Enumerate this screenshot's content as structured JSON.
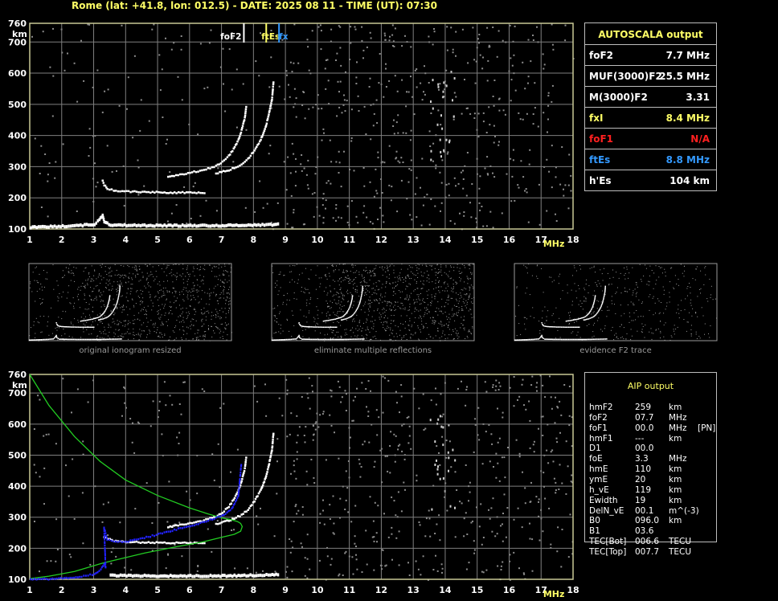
{
  "header": "Rome (lat: +41.8, lon: 012.5) - DATE: 2025 08 11 - TIME (UT): 07:30",
  "colors": {
    "background": "#000000",
    "grid": "#7f7f7f",
    "frame": "#c8c896",
    "trace": "#ffffff",
    "noise": "#8c8c8c",
    "label_yellow": "#ffff66",
    "label_red": "#ff2020",
    "label_blue": "#3399ff",
    "profile_green": "#22cc22",
    "fit_blue": "#2222ff"
  },
  "autoscala": {
    "title": "AUTOSCALA output",
    "rows": [
      {
        "name": "foF2",
        "value": "7.7 MHz",
        "color": "#ffffff"
      },
      {
        "name": "MUF(3000)F2",
        "value": "25.5 MHz",
        "color": "#ffffff"
      },
      {
        "name": "M(3000)F2",
        "value": "3.31",
        "color": "#ffffff"
      },
      {
        "name": "fxI",
        "value": "8.4 MHz",
        "color": "#ffff66"
      },
      {
        "name": "foF1",
        "value": "N/A",
        "color": "#ff2020"
      },
      {
        "name": "ftEs",
        "value": "8.8 MHz",
        "color": "#3399ff"
      },
      {
        "name": "h'Es",
        "value": "104    km",
        "color": "#ffffff"
      }
    ]
  },
  "aip": {
    "title": "AIP output",
    "rows": [
      {
        "name": "hmF2",
        "value": "259",
        "unit": "km",
        "extra": ""
      },
      {
        "name": "foF2",
        "value": "07.7",
        "unit": "MHz",
        "extra": ""
      },
      {
        "name": "foF1",
        "value": "00.0",
        "unit": "MHz",
        "extra": "[PN]"
      },
      {
        "name": "hmF1",
        "value": "---",
        "unit": "km",
        "extra": ""
      },
      {
        "name": "D1",
        "value": "00.0",
        "unit": "",
        "extra": ""
      },
      {
        "name": "foE",
        "value": "3.3",
        "unit": "MHz",
        "extra": ""
      },
      {
        "name": "hmE",
        "value": "110",
        "unit": "km",
        "extra": ""
      },
      {
        "name": "ymE",
        "value": "20",
        "unit": "km",
        "extra": ""
      },
      {
        "name": "h_vE",
        "value": "119",
        "unit": "km",
        "extra": ""
      },
      {
        "name": "Ewidth",
        "value": "19",
        "unit": "km",
        "extra": ""
      },
      {
        "name": "DelN_vE",
        "value": "00.1",
        "unit": "m^(-3)",
        "extra": ""
      },
      {
        "name": "B0",
        "value": "096.0",
        "unit": "km",
        "extra": ""
      },
      {
        "name": "B1",
        "value": "03.6",
        "unit": "",
        "extra": ""
      },
      {
        "name": "TEC[Bot]",
        "value": "006.6",
        "unit": "TECU",
        "extra": ""
      },
      {
        "name": "TEC[Top]",
        "value": "007.7",
        "unit": "TECU",
        "extra": ""
      }
    ]
  },
  "thumbnails": [
    {
      "caption": "original ionogram resized"
    },
    {
      "caption": "eliminate multiple reflections"
    },
    {
      "caption": "evidence F2 trace"
    }
  ],
  "chart_data": [
    {
      "type": "scatter",
      "title": "",
      "xlabel": "MHz",
      "ylabel": "km",
      "xlim": [
        1,
        18
      ],
      "ylim": [
        100,
        760
      ],
      "xticks": [
        1,
        2,
        3,
        4,
        5,
        6,
        7,
        8,
        9,
        10,
        11,
        12,
        13,
        14,
        15,
        16,
        17,
        18
      ],
      "yticks": [
        100,
        200,
        300,
        400,
        500,
        600,
        700,
        760
      ],
      "grid": true,
      "markers": [
        {
          "label": "foF2",
          "freq": 7.7,
          "color": "#ffffff"
        },
        {
          "label": "ftEs",
          "freq": 8.4,
          "color": "#ffff66"
        },
        {
          "label": "fx",
          "freq": 8.8,
          "color": "#3399ff"
        }
      ],
      "series": [
        {
          "role": "Es_trace",
          "color": "#ffffff",
          "x": [
            1.0,
            1.5,
            2.0,
            2.5,
            3.0,
            3.15,
            3.25,
            3.3,
            3.5,
            4.0,
            5.0,
            6.0,
            7.0,
            7.5,
            8.0,
            8.5,
            8.8
          ],
          "y": [
            110,
            112,
            114,
            116,
            120,
            135,
            150,
            130,
            118,
            117,
            116,
            116,
            116,
            117,
            118,
            119,
            120
          ]
        },
        {
          "role": "E_trace",
          "color": "#ffffff",
          "x": [
            3.25,
            3.3,
            3.4,
            3.6,
            3.8,
            4.0,
            4.5,
            5.0,
            5.5,
            6.0,
            6.5
          ],
          "y": [
            258,
            245,
            232,
            227,
            225,
            224,
            222,
            221,
            220,
            220,
            220
          ]
        },
        {
          "role": "F2_o_trace",
          "color": "#ffffff",
          "x": [
            5.3,
            5.8,
            6.3,
            6.8,
            7.0,
            7.2,
            7.35,
            7.5,
            7.6,
            7.7,
            7.75
          ],
          "y": [
            272,
            280,
            290,
            305,
            318,
            338,
            360,
            390,
            420,
            460,
            500
          ]
        },
        {
          "role": "F2_x_trace",
          "color": "#ffffff",
          "x": [
            6.8,
            7.2,
            7.6,
            7.8,
            8.0,
            8.2,
            8.35,
            8.45,
            8.55,
            8.6
          ],
          "y": [
            282,
            292,
            310,
            328,
            355,
            390,
            430,
            470,
            520,
            580
          ]
        }
      ]
    },
    {
      "type": "scatter",
      "title": "",
      "xlabel": "MHz",
      "ylabel": "km",
      "xlim": [
        1,
        18
      ],
      "ylim": [
        100,
        760
      ],
      "xticks": [
        1,
        2,
        3,
        4,
        5,
        6,
        7,
        8,
        9,
        10,
        11,
        12,
        13,
        14,
        15,
        16,
        17,
        18
      ],
      "yticks": [
        100,
        200,
        300,
        400,
        500,
        600,
        700,
        760
      ],
      "grid": true,
      "series": [
        {
          "role": "Es_trace",
          "color": "#ffffff",
          "x": [
            3.5,
            4.0,
            5.0,
            6.0,
            7.0,
            7.5,
            8.0,
            8.5,
            8.8
          ],
          "y": [
            118,
            117,
            116,
            116,
            116,
            117,
            118,
            119,
            120
          ]
        },
        {
          "role": "E_trace",
          "color": "#ffffff",
          "x": [
            3.3,
            3.6,
            4.0,
            4.5,
            5.0,
            5.5,
            6.0,
            6.5
          ],
          "y": [
            240,
            226,
            224,
            222,
            221,
            220,
            220,
            220
          ]
        },
        {
          "role": "F2_o_trace",
          "color": "#ffffff",
          "x": [
            5.3,
            5.8,
            6.3,
            6.8,
            7.0,
            7.2,
            7.35,
            7.5,
            7.6,
            7.7,
            7.75
          ],
          "y": [
            272,
            280,
            290,
            305,
            318,
            338,
            360,
            390,
            420,
            460,
            500
          ]
        },
        {
          "role": "F2_x_trace",
          "color": "#ffffff",
          "x": [
            6.8,
            7.2,
            7.6,
            7.8,
            8.0,
            8.2,
            8.35,
            8.45,
            8.55,
            8.6
          ],
          "y": [
            282,
            292,
            310,
            328,
            355,
            390,
            430,
            470,
            520,
            580
          ]
        },
        {
          "role": "profile",
          "color": "#22cc22",
          "x": [
            1.0,
            1.6,
            2.4,
            3.2,
            4.0,
            5.0,
            6.0,
            6.6,
            7.0,
            7.3,
            7.5,
            7.6,
            7.65,
            7.6,
            7.4,
            7.0,
            6.4,
            5.6,
            4.6,
            3.6,
            3.2,
            2.4,
            1.6,
            1.0
          ],
          "y": [
            760,
            660,
            560,
            480,
            420,
            370,
            330,
            310,
            298,
            292,
            286,
            280,
            270,
            255,
            245,
            235,
            220,
            205,
            185,
            160,
            150,
            125,
            110,
            102
          ]
        },
        {
          "role": "fitted_trace",
          "color": "#2222ff",
          "x": [
            1.0,
            2.0,
            2.6,
            3.0,
            3.2,
            3.3,
            3.35,
            3.3,
            3.4,
            3.6,
            4.0,
            4.5,
            5.0,
            5.5,
            6.0,
            6.5,
            7.0,
            7.3,
            7.5,
            7.6
          ],
          "y": [
            102,
            106,
            112,
            120,
            135,
            150,
            140,
            270,
            232,
            226,
            224,
            235,
            248,
            262,
            275,
            290,
            308,
            330,
            370,
            480
          ]
        }
      ]
    }
  ]
}
